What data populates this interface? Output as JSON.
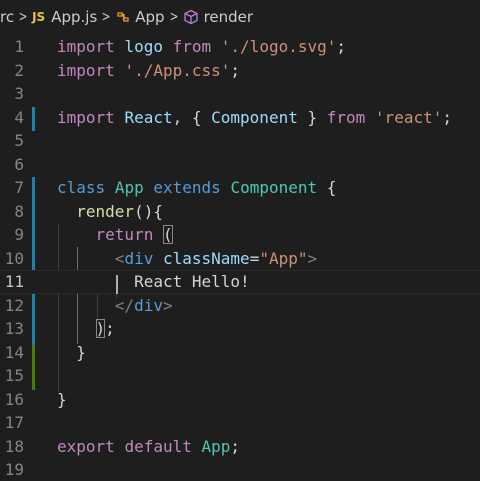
{
  "breadcrumb": {
    "folder": "rc",
    "file_badge": "JS",
    "file": "App.js",
    "class": "App",
    "method": "render",
    "separator": ">"
  },
  "editor": {
    "current_line": 11,
    "lines": [
      {
        "n": "1",
        "tokens": [
          [
            "kw-purple",
            "import"
          ],
          [
            "plain",
            " "
          ],
          [
            "var",
            "logo"
          ],
          [
            "plain",
            " "
          ],
          [
            "kw-purple",
            "from"
          ],
          [
            "plain",
            " "
          ],
          [
            "str",
            "'./logo.svg'"
          ],
          [
            "plain",
            ";"
          ]
        ]
      },
      {
        "n": "2",
        "tokens": [
          [
            "kw-purple",
            "import"
          ],
          [
            "plain",
            " "
          ],
          [
            "str",
            "'./App.css'"
          ],
          [
            "plain",
            ";"
          ]
        ]
      },
      {
        "n": "3",
        "tokens": []
      },
      {
        "n": "4",
        "tokens": [
          [
            "kw-purple",
            "import"
          ],
          [
            "plain",
            " "
          ],
          [
            "var",
            "React"
          ],
          [
            "plain",
            ", { "
          ],
          [
            "var",
            "Component"
          ],
          [
            "plain",
            " } "
          ],
          [
            "kw-purple",
            "from"
          ],
          [
            "plain",
            " "
          ],
          [
            "str",
            "'react'"
          ],
          [
            "plain",
            ";"
          ]
        ]
      },
      {
        "n": "5",
        "tokens": []
      },
      {
        "n": "6",
        "tokens": []
      },
      {
        "n": "7",
        "tokens": [
          [
            "kw-blue",
            "class"
          ],
          [
            "plain",
            " "
          ],
          [
            "cls",
            "App"
          ],
          [
            "plain",
            " "
          ],
          [
            "kw-blue",
            "extends"
          ],
          [
            "plain",
            " "
          ],
          [
            "cls",
            "Component"
          ],
          [
            "plain",
            " {"
          ]
        ]
      },
      {
        "n": "8",
        "tokens": [
          [
            "plain",
            "  "
          ],
          [
            "fn",
            "render"
          ],
          [
            "plain",
            "(){"
          ]
        ]
      },
      {
        "n": "9",
        "tokens": [
          [
            "plain",
            "    "
          ],
          [
            "kw-purple",
            "return"
          ],
          [
            "plain",
            " "
          ],
          [
            "plain bracket-hl",
            "("
          ]
        ]
      },
      {
        "n": "10",
        "tokens": [
          [
            "plain",
            "      "
          ],
          [
            "tagpunct",
            "<"
          ],
          [
            "kw-blue",
            "div"
          ],
          [
            "plain",
            " "
          ],
          [
            "attr",
            "className"
          ],
          [
            "plain",
            "="
          ],
          [
            "str",
            "\"App\""
          ],
          [
            "tagpunct",
            ">"
          ]
        ]
      },
      {
        "n": "11",
        "tokens": [
          [
            "plain",
            "        React Hello!"
          ]
        ]
      },
      {
        "n": "12",
        "tokens": [
          [
            "plain",
            "      "
          ],
          [
            "tagpunct",
            "</"
          ],
          [
            "kw-blue",
            "div"
          ],
          [
            "tagpunct",
            ">"
          ]
        ]
      },
      {
        "n": "13",
        "tokens": [
          [
            "plain",
            "    "
          ],
          [
            "plain bracket-hl",
            ")"
          ],
          [
            "plain",
            ";"
          ]
        ]
      },
      {
        "n": "14",
        "tokens": [
          [
            "plain",
            "  }"
          ]
        ]
      },
      {
        "n": "15",
        "tokens": []
      },
      {
        "n": "16",
        "tokens": [
          [
            "plain",
            "}"
          ]
        ]
      },
      {
        "n": "17",
        "tokens": []
      },
      {
        "n": "18",
        "tokens": [
          [
            "kw-purple",
            "export"
          ],
          [
            "plain",
            " "
          ],
          [
            "kw-purple",
            "default"
          ],
          [
            "plain",
            " "
          ],
          [
            "cls",
            "App"
          ],
          [
            "plain",
            ";"
          ]
        ]
      },
      {
        "n": "19",
        "tokens": []
      }
    ]
  },
  "colors": {
    "background": "#1e1e1e",
    "gutter_modified": "#1b81a8",
    "gutter_added": "#487e02",
    "js_badge": "#e8c43f"
  }
}
